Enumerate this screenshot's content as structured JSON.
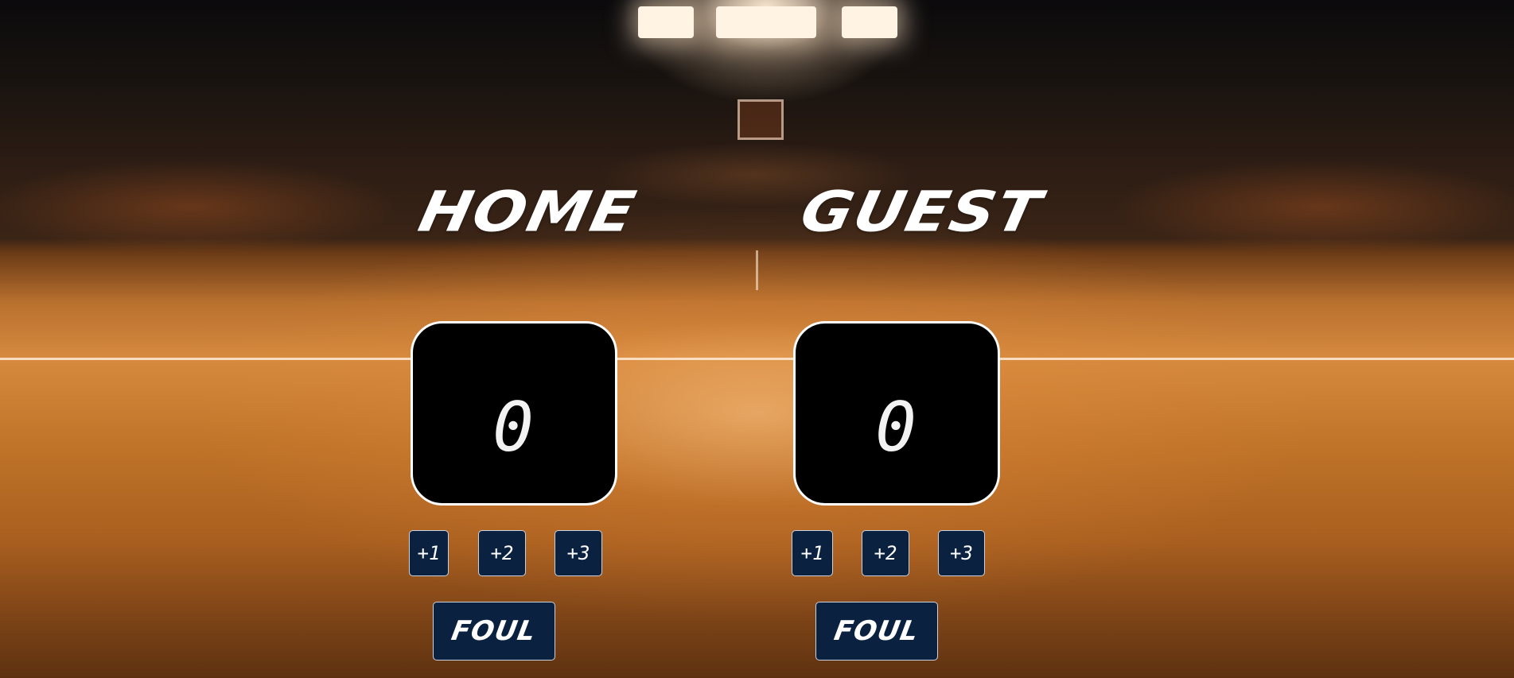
{
  "home": {
    "title": "HOME",
    "score": "0",
    "buttons": {
      "plus1": "+1",
      "plus2": "+2",
      "plus3": "+3"
    },
    "foul_label": "FOUL"
  },
  "guest": {
    "title": "GUEST",
    "score": "0",
    "buttons": {
      "plus1": "+1",
      "plus2": "+2",
      "plus3": "+3"
    },
    "foul_label": "FOUL"
  },
  "colors": {
    "button_bg": "#0a2140",
    "score_bg": "#000000",
    "text": "#ffffff"
  }
}
